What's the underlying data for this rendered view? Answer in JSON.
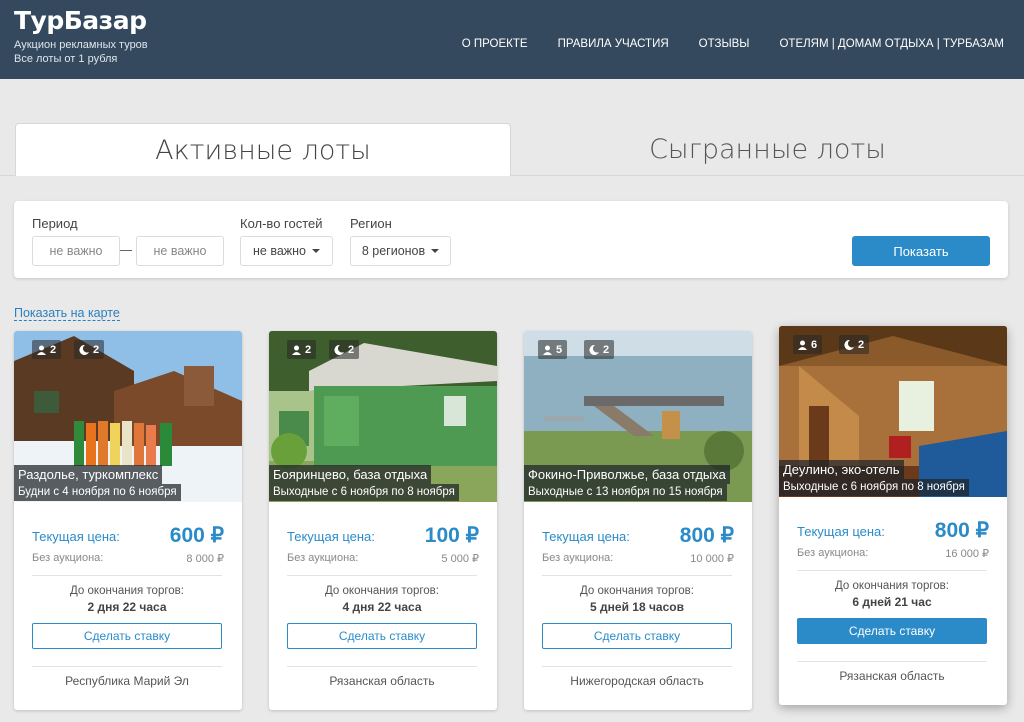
{
  "header": {
    "logo": "ТурБазар",
    "tagline_1": "Аукцион рекламных туров",
    "tagline_2": "Все лоты от 1 рубля",
    "nav": [
      "О ПРОЕКТЕ",
      "ПРАВИЛА УЧАСТИЯ",
      "ОТЗЫВЫ",
      "ОТЕЛЯМ | ДОМАМ ОТДЫХА | ТУРБАЗАМ"
    ]
  },
  "tabs": {
    "active": "Активные лоты",
    "inactive": "Сыгранные лоты"
  },
  "filter": {
    "period_label": "Период",
    "period_from_placeholder": "не важно",
    "period_to_placeholder": "не важно",
    "guests_label": "Кол-во гостей",
    "guests_value": "не важно",
    "region_label": "Регион",
    "region_value": "8 регионов",
    "show_button": "Показать"
  },
  "map_link": "Показать на карте",
  "labels": {
    "current_price": "Текущая цена:",
    "no_auction": "Без аукциона:",
    "until_end": "До окончания торгов:",
    "bid_button": "Сделать ставку"
  },
  "cards": [
    {
      "guests": "2",
      "nights": "2",
      "title": "Раздолье, туркомплекс",
      "dates": "Будни с 4 ноября по 6 ноября",
      "price": "600 ₽",
      "old_price": "8 000 ₽",
      "time_left": "2 дня 22 часа",
      "region": "Республика Марий Эл"
    },
    {
      "guests": "2",
      "nights": "2",
      "title": "Бояринцево, база отдыха",
      "dates": "Выходные с 6 ноября по 8 ноября",
      "price": "100 ₽",
      "old_price": "5 000 ₽",
      "time_left": "4 дня 22 часа",
      "region": "Рязанская область"
    },
    {
      "guests": "5",
      "nights": "2",
      "title": "Фокино-Приволжье, база отдыха",
      "dates": "Выходные с 13 ноября по 15 ноября",
      "price": "800 ₽",
      "old_price": "10 000 ₽",
      "time_left": "5 дней 18 часов",
      "region": "Нижегородская область"
    },
    {
      "guests": "6",
      "nights": "2",
      "title": "Деулино, эко-отель",
      "dates": "Выходные с 6 ноября по 8 ноября",
      "price": "800 ₽",
      "old_price": "16 000 ₽",
      "time_left": "6 дней 21 час",
      "region": "Рязанская область"
    }
  ]
}
